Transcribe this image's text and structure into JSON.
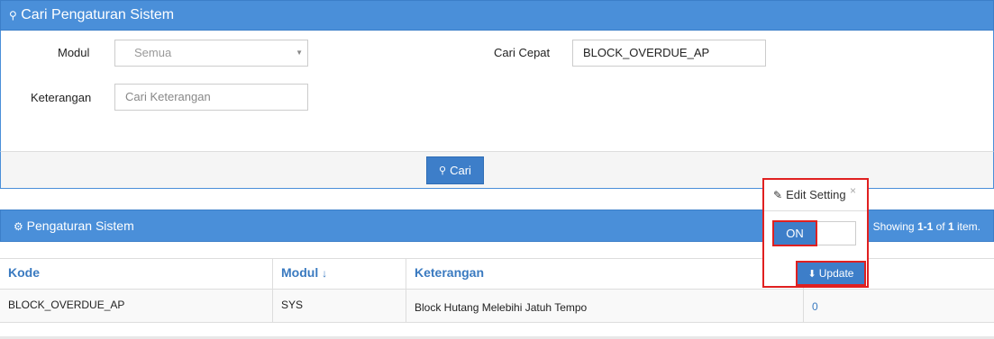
{
  "search_panel": {
    "title": "Cari Pengaturan Sistem",
    "modul_label": "Modul",
    "modul_value": "Semua",
    "keterangan_label": "Keterangan",
    "keterangan_placeholder": "Cari Keterangan",
    "cari_cepat_label": "Cari Cepat",
    "cari_cepat_value": "BLOCK_OVERDUE_AP",
    "cari_button": "Cari"
  },
  "list_panel": {
    "title": "Pengaturan Sistem",
    "summary_prefix": "Showing ",
    "summary_range": "1-1",
    "summary_mid": " of ",
    "summary_total": "1",
    "summary_suffix": " item."
  },
  "table": {
    "columns": [
      "Kode",
      "Modul",
      "Keterangan"
    ],
    "rows": [
      {
        "kode": "BLOCK_OVERDUE_AP",
        "modul": "SYS",
        "keterangan": "Block Hutang Melebihi Jatuh Tempo",
        "value": "0"
      }
    ]
  },
  "popover": {
    "title": "Edit Setting",
    "close": "×",
    "toggle_on": "ON",
    "update_button": "Update"
  }
}
